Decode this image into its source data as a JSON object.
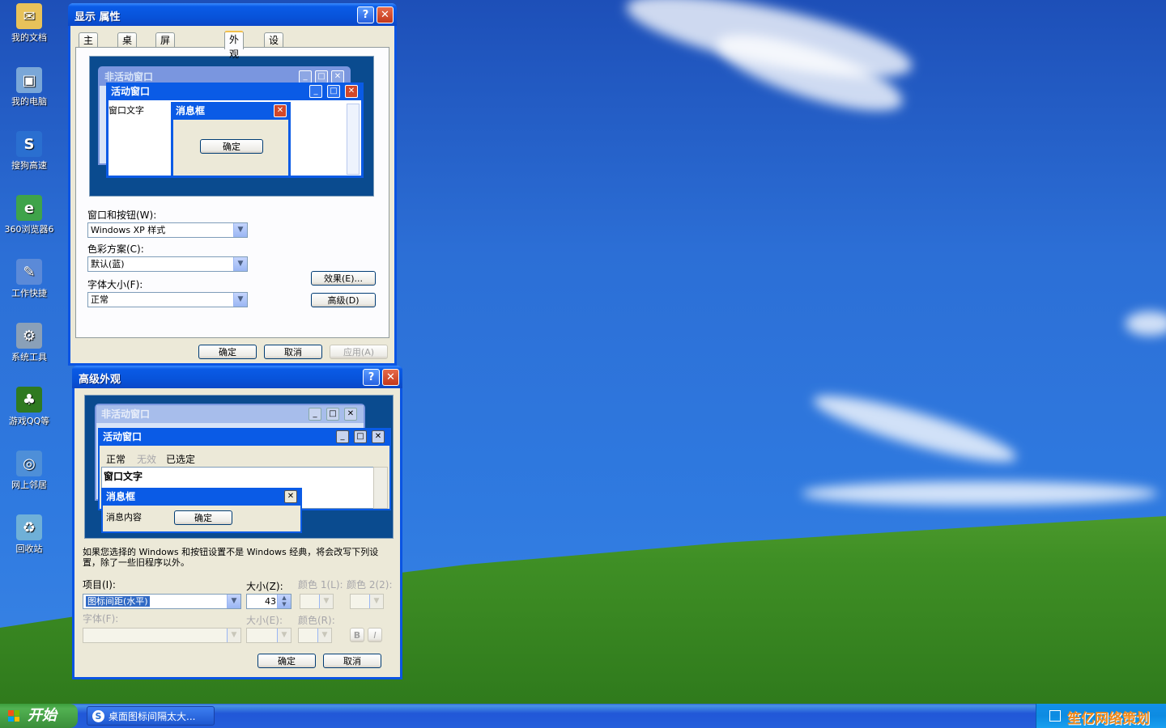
{
  "desktop_icons": [
    {
      "label": "我的文档",
      "icon": "documents-icon",
      "color": "#e8c25a",
      "glyph": "✉"
    },
    {
      "label": "我的电脑",
      "icon": "computer-icon",
      "color": "#7aa7d8",
      "glyph": "▣"
    },
    {
      "label": "搜狗高速",
      "icon": "sogou-browser-icon",
      "color": "#2a6fd0",
      "glyph": "S"
    },
    {
      "label": "360浏览器6",
      "icon": "browser-360-icon",
      "color": "#3fa34a",
      "glyph": "e"
    },
    {
      "label": "工作快捷",
      "icon": "work-shortcut-icon",
      "color": "#5b8ad8",
      "glyph": "✎"
    },
    {
      "label": "系统工具",
      "icon": "system-tools-icon",
      "color": "#8aa0b8",
      "glyph": "⚙"
    },
    {
      "label": "游戏QQ等",
      "icon": "tree-games-icon",
      "color": "#2f7a20",
      "glyph": "♣"
    },
    {
      "label": "网上邻居",
      "icon": "network-icon",
      "color": "#4e8fd8",
      "glyph": "◎"
    },
    {
      "label": "回收站",
      "icon": "recycle-bin-icon",
      "color": "#6fb0d8",
      "glyph": "♻"
    }
  ],
  "display_props": {
    "title": "显示 属性",
    "tabs": [
      "主题",
      "桌面",
      "屏幕保护程序",
      "外观",
      "设置"
    ],
    "active_tab": "外观",
    "preview": {
      "inactive_title": "非活动窗口",
      "active_title": "活动窗口",
      "window_text": "窗口文字",
      "msgbox_title": "消息框",
      "ok": "确定"
    },
    "windows_buttons_label": "窗口和按钮(W):",
    "windows_buttons_value": "Windows XP 样式",
    "color_scheme_label": "色彩方案(C):",
    "color_scheme_value": "默认(蓝)",
    "font_size_label": "字体大小(F):",
    "font_size_value": "正常",
    "effects_button": "效果(E)...",
    "advanced_button": "高级(D)",
    "ok": "确定",
    "cancel": "取消",
    "apply": "应用(A)"
  },
  "advanced": {
    "title": "高级外观",
    "preview": {
      "inactive_title": "非活动窗口",
      "active_title": "活动窗口",
      "menu_normal": "正常",
      "menu_disabled": "无效",
      "menu_selected": "已选定",
      "window_text": "窗口文字",
      "msgbox_title": "消息框",
      "msg_content": "消息内容",
      "ok": "确定"
    },
    "note": "如果您选择的 Windows 和按钮设置不是 Windows 经典，将会改写下列设置，除了一些旧程序以外。",
    "item_label": "项目(I):",
    "item_value": "图标间距(水平)",
    "size_label": "大小(Z):",
    "size_value": "43",
    "color1_label": "颜色 1(L):",
    "color2_label": "颜色 2(2):",
    "font_label": "字体(F):",
    "font_size_label": "大小(E):",
    "font_color_label": "颜色(R):",
    "bold": "B",
    "italic": "I",
    "ok": "确定",
    "cancel": "取消"
  },
  "taskbar": {
    "start": "开始",
    "task": "桌面图标间隔太大...",
    "watermark": "笙亿网络策划"
  }
}
